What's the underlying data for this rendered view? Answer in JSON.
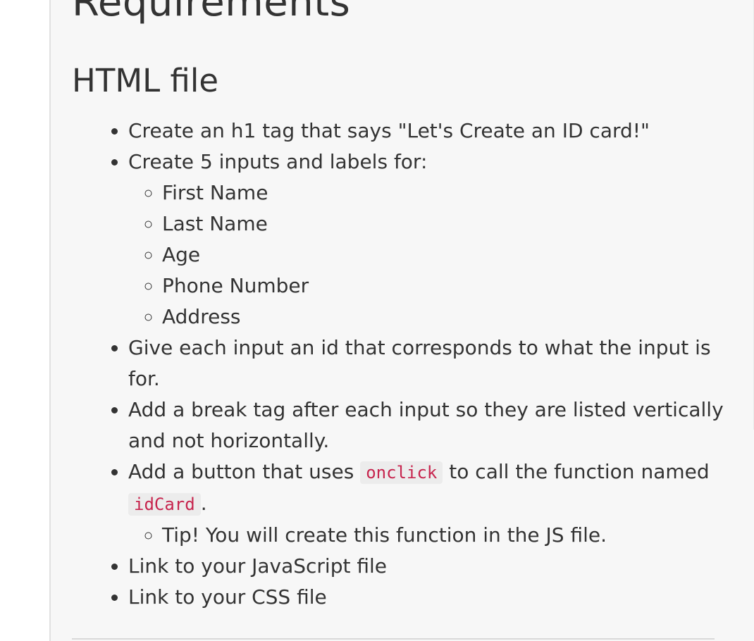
{
  "page": {
    "title": "Requirements",
    "section_title": "HTML file"
  },
  "items": {
    "h1_tag": "Create an h1 tag that says \"Let's Create an ID card!\"",
    "inputs_intro": "Create 5 inputs and labels for:",
    "inputs": [
      "First Name",
      "Last Name",
      "Age",
      "Phone Number",
      "Address"
    ],
    "give_id": "Give each input an id that corresponds to what the input is for.",
    "break_tag": "Add a break tag after each input so they are listed vertically and not horizontally.",
    "button_pre": "Add a button that uses ",
    "button_code_onclick": "onclick",
    "button_mid": " to call the function named ",
    "button_code_fn": "idCard",
    "button_post": ".",
    "tip": "Tip! You will create this function in the JS file.",
    "link_js": "Link to your JavaScript file",
    "link_css": "Link to your CSS file"
  }
}
